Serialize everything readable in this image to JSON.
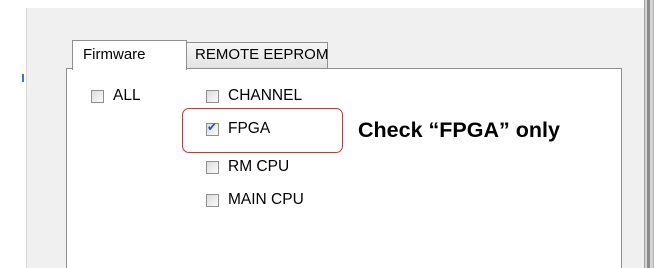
{
  "tabs": [
    {
      "label": "Firmware",
      "active": true
    },
    {
      "label": "REMOTE EEPROM",
      "active": false
    }
  ],
  "options": {
    "all": {
      "label": "ALL",
      "checked": false
    },
    "channel": {
      "label": "CHANNEL",
      "checked": false
    },
    "fpga": {
      "label": "FPGA",
      "checked": true
    },
    "rm_cpu": {
      "label": "RM CPU",
      "checked": false
    },
    "main_cpu": {
      "label": "MAIN CPU",
      "checked": false
    }
  },
  "annotation": {
    "text": "Check “FPGA” only",
    "color": "#e12a2a"
  },
  "colors": {
    "panel_bg": "#f0f0f0",
    "check_mark": "#2a4fa8"
  }
}
